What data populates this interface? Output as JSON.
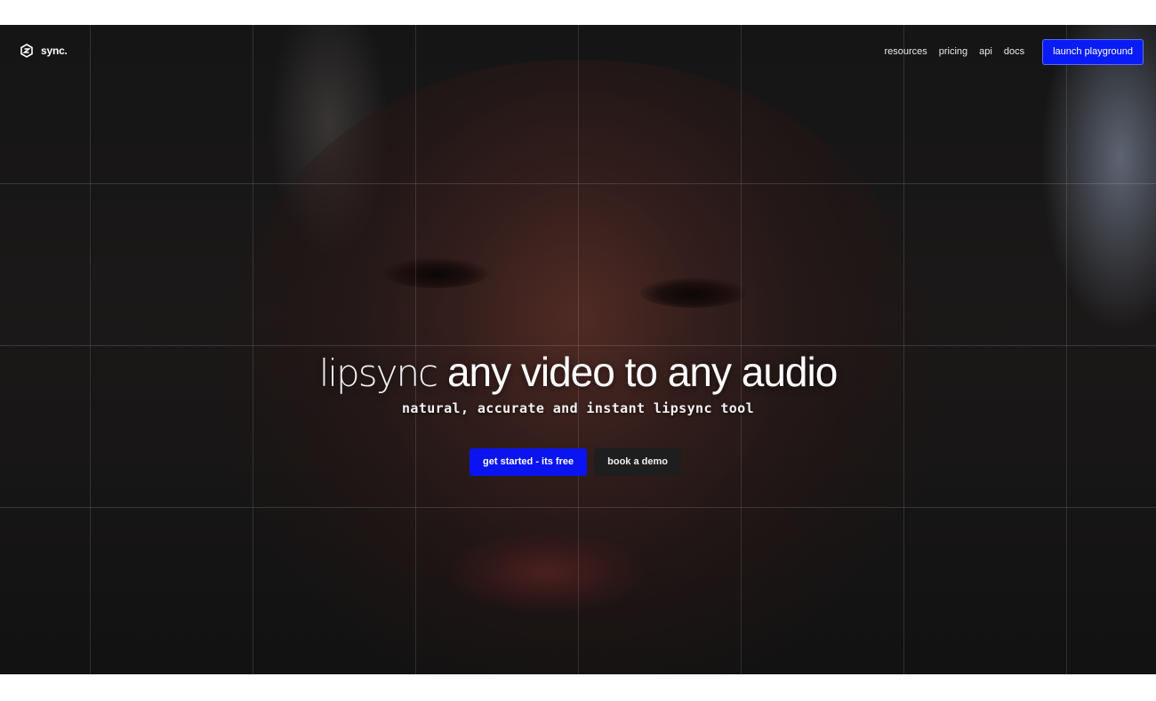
{
  "brand": {
    "name": "sync.",
    "logo_icon": "sync-logo-icon"
  },
  "nav": {
    "links": [
      {
        "label": "resources"
      },
      {
        "label": "pricing"
      },
      {
        "label": "api"
      },
      {
        "label": "docs"
      }
    ],
    "cta_label": "launch playground"
  },
  "hero": {
    "headline_light": "lipsync",
    "headline_strong_1": "any video",
    "headline_mid": "to",
    "headline_strong_2": "any audio",
    "subheadline": "natural, accurate and instant lipsync tool",
    "primary_cta": "get started - its free",
    "secondary_cta": "book a demo"
  },
  "colors": {
    "accent": "#0a14f0",
    "background": "#151515",
    "text": "#ffffff"
  }
}
